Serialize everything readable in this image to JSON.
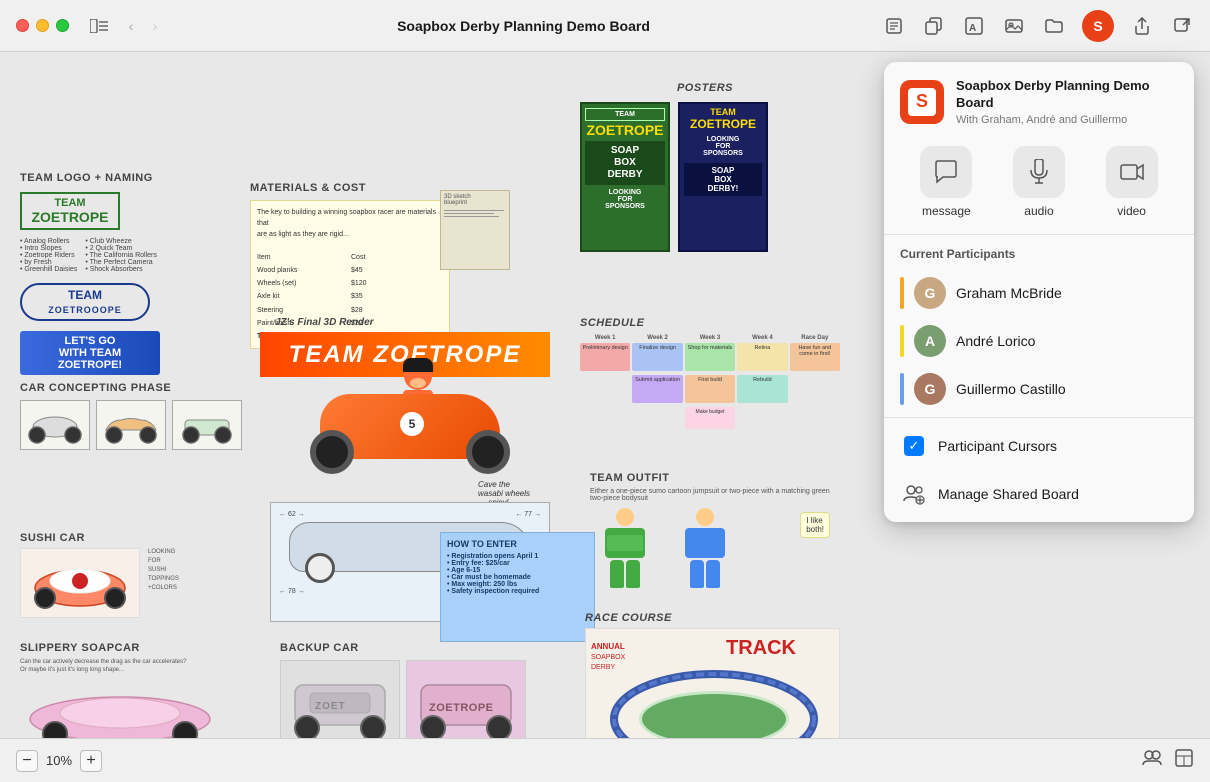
{
  "window": {
    "title": "Soapbox Derby Planning Demo Board"
  },
  "titlebar": {
    "back_label": "‹",
    "forward_label": "›",
    "title": "Soapbox Derby Planning Demo Board",
    "icon_notes": "☰",
    "icon_copy": "⧉",
    "icon_text": "T",
    "icon_image": "🖼",
    "icon_folder": "📁",
    "icon_share": "↑",
    "icon_external": "⤢",
    "user_initial": "S"
  },
  "panel": {
    "board_title": "Soapbox Derby Planning Demo Board",
    "board_subtitle": "With Graham, André and Guillermo",
    "actions": [
      {
        "id": "message",
        "label": "message",
        "icon": "💬"
      },
      {
        "id": "audio",
        "label": "audio",
        "icon": "📞"
      },
      {
        "id": "video",
        "label": "video",
        "icon": "📹"
      }
    ],
    "section_title": "Current Participants",
    "participants": [
      {
        "name": "Graham McBride",
        "color": "#f5a623",
        "avatar_bg": "#c8a882",
        "initial": "G"
      },
      {
        "name": "André Lorico",
        "color": "#f5d623",
        "avatar_bg": "#7a9e6f",
        "initial": "A"
      },
      {
        "name": "Guillermo Castillo",
        "color": "#6b9de8",
        "avatar_bg": "#a87860",
        "initial": "G"
      }
    ],
    "options": [
      {
        "id": "participant-cursors",
        "label": "Participant Cursors",
        "icon": "checkbox",
        "checked": true
      },
      {
        "id": "manage-shared-board",
        "label": "Manage Shared Board",
        "icon": "people"
      }
    ]
  },
  "bottombar": {
    "zoom_minus": "−",
    "zoom_level": "10%",
    "zoom_plus": "+",
    "icon_collab": "👥",
    "icon_layout": "⬜"
  },
  "canvas": {
    "sections": {
      "posters_label": "POSTERS",
      "schedule_label": "SCHEDULE",
      "team_logo_label": "TEAM LOGO + NAMING",
      "materials_label": "MATERIALS & COST",
      "car_concept_label": "CAR CONCEPTING PHASE",
      "team_outfit_label": "TEAM OUTFIT",
      "sushi_car_label": "SUSHI CAR",
      "slippery_label": "SLIPPERY SOAPCAR",
      "backup_car_label": "BACKUP CAR",
      "race_course_label": "RACE COURSE",
      "how_enter_label": "HOW TO ENTER",
      "render_label": "JZ's Final 3D Render"
    }
  }
}
